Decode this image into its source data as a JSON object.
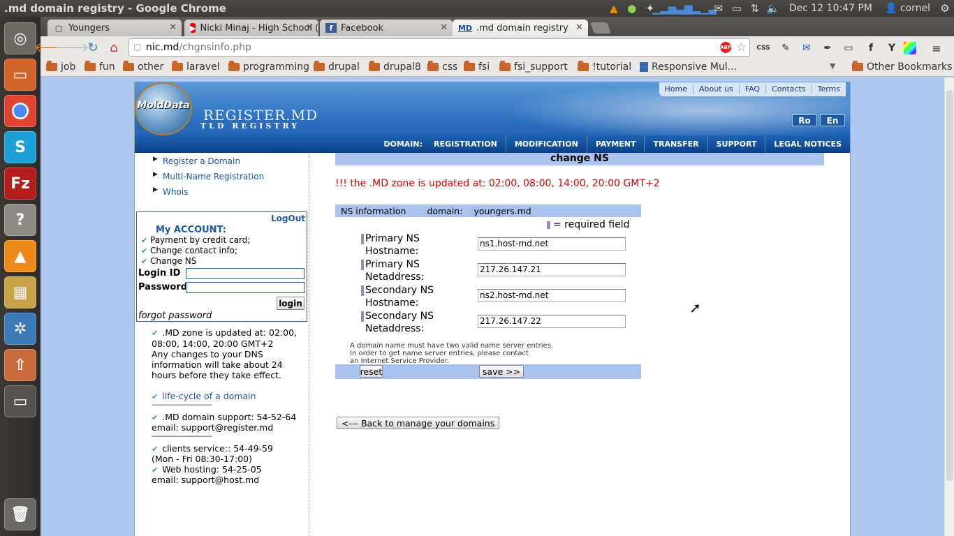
{
  "window": {
    "title": ".md domain registry - Google Chrome"
  },
  "tray": {
    "clock": "Dec 12 10:47 PM",
    "user": "cornel"
  },
  "tabs": [
    {
      "label": "Youngers",
      "favicon": "page-icon"
    },
    {
      "label": "Nicki Minaj - High School (",
      "favicon": "youtube-icon"
    },
    {
      "label": "Facebook",
      "favicon": "facebook-icon"
    },
    {
      "label": ".md domain registry",
      "favicon": "md-icon",
      "favtext": "MD"
    }
  ],
  "toolbar": {
    "url_host": "nic.md",
    "url_path": "/chgnsinfo.php"
  },
  "bookmarks": [
    "job",
    "fun",
    "other",
    "laravel",
    "programming",
    "drupal",
    "drupal8",
    "css",
    "fsi",
    "fsi_support",
    "!tutorial",
    "Responsive Mul...",
    "Other Bookmarks"
  ],
  "site": {
    "logo_text": "MoldData",
    "title": "REGISTER.MD",
    "subtitle": "TLD REGISTRY",
    "toplinks": [
      "Home",
      "About us",
      "FAQ",
      "Contacts",
      "Terms"
    ],
    "lang": [
      "Ro",
      "En"
    ],
    "nav_label": "DOMAIN:",
    "nav": [
      "REGISTRATION",
      "MODIFICATION",
      "PAYMENT",
      "TRANSFER",
      "SUPPORT",
      "LEGAL NOTICES"
    ]
  },
  "sidebar": {
    "links": [
      "Register a Domain",
      "Multi-Name Registration",
      "Whois"
    ],
    "logout": "LogOut",
    "account_title": "My ACCOUNT:",
    "account_items": [
      "Payment by credit card;",
      "Change contact info;",
      "Change NS"
    ],
    "login_label": "Login ID",
    "password_label": "Password",
    "login_button": "login",
    "forgot": "forgot password",
    "info": {
      "zone": ".MD zone is updated at: 02:00, 08:00, 14:00, 20:00 GMT+2",
      "dns": "Any changes to your DNS information will take about 24 hours before they take effect.",
      "lifecycle": "life-cycle of a domain",
      "sep": "---------------------------------",
      "support": ".MD domain support: 54-52-64",
      "support_email": "email: support@register.md",
      "clients": "clients service:: 54-49-59",
      "clients_hours": "(Mon - Fri 08:30-17:00)",
      "hosting": "Web hosting: 54-25-05",
      "hosting_email": "email: support@host.md"
    }
  },
  "main": {
    "heading": "change NS",
    "notice": "!!! the .MD zone is updated at: 02:00, 08:00, 14:00, 20:00 GMT+2",
    "ns_info_label": "NS information",
    "domain_label": "domain:",
    "domain_value": "youngers.md",
    "required": "= required field",
    "fields": [
      {
        "label1": "Primary NS",
        "label2": "Hostname:",
        "value": "ns1.host-md.net"
      },
      {
        "label1": "Primary NS",
        "label2": "Netaddress:",
        "value": "217.26.147.21"
      },
      {
        "label1": "Secondary NS",
        "label2": "Hostname:",
        "value": "ns2.host-md.net"
      },
      {
        "label1": "Secondary NS",
        "label2": "Netaddress:",
        "value": "217.26.147.22"
      }
    ],
    "note1": "A domain name must have two valid name server entries.",
    "note2": "In order to get name server entries, please contact",
    "note3": "an Internet Service Provider.",
    "reset": "reset",
    "save": "save  >>",
    "back": "<--- Back to manage your domains"
  }
}
